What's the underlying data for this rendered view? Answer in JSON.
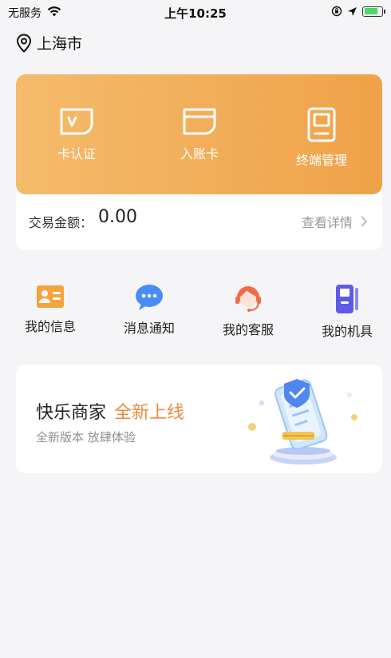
{
  "status_bar": {
    "carrier": "无服务",
    "time": "上午10:25",
    "battery_level": 0.8
  },
  "location": {
    "city": "上海市"
  },
  "card": {
    "actions": [
      {
        "label": "卡认证",
        "icon": "card-verify-icon"
      },
      {
        "label": "入账卡",
        "icon": "card-icon"
      },
      {
        "label": "终端管理",
        "icon": "terminal-icon"
      }
    ],
    "amount_label": "交易金额：",
    "amount_value": "0.00",
    "detail_link": "查看详情"
  },
  "quick_menu": [
    {
      "label": "我的信息",
      "icon": "id-card-icon",
      "color": "#f5a33c"
    },
    {
      "label": "消息通知",
      "icon": "chat-bubble-icon",
      "color": "#4a8cf5"
    },
    {
      "label": "我的客服",
      "icon": "customer-service-icon",
      "color": "#f06a4a"
    },
    {
      "label": "我的机具",
      "icon": "pos-device-icon",
      "color": "#5b5be8"
    }
  ],
  "banner": {
    "title": "快乐商家",
    "highlight": "全新上线",
    "subtitle": "全新版本 放肆体验",
    "highlight_color": "#ef8a3e"
  }
}
